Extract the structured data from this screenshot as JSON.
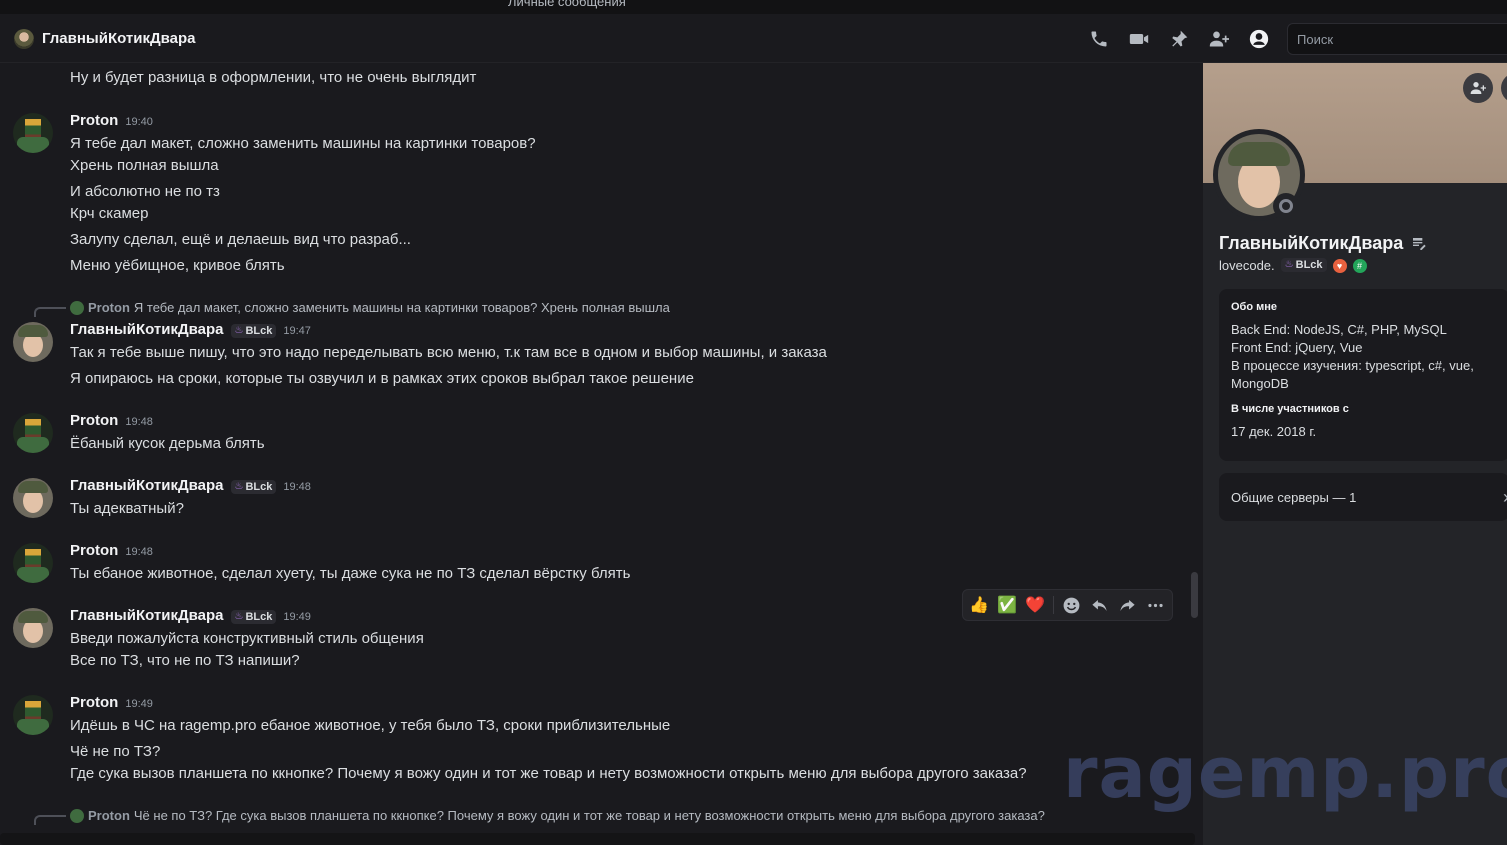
{
  "titlebar": {
    "text": "Личные сообщения"
  },
  "header": {
    "title": "ГлавныйКотикДвара",
    "search_placeholder": "Поиск"
  },
  "messages": {
    "m0_line": "Ну и будет разница в оформлении, что не очень выглядит",
    "m1": {
      "author": "Proton",
      "time": "19:40",
      "lines": [
        "Я тебе дал макет, сложно заменить машины на картинки товаров?",
        "Хрень полная вышла",
        "И абсолютно не по тз",
        "Крч скамер",
        "Залупу сделал, ещё и делаешь вид что разраб...",
        "Меню уёбищное, кривое блять"
      ]
    },
    "m2": {
      "reply_author": "Proton",
      "reply_text": "Я тебе дал макет, сложно заменить машины на картинки товаров? Хрень полная вышла",
      "author": "ГлавныйКотикДвара",
      "tag": "BLck",
      "time": "19:47",
      "lines": [
        "Так я тебе выше пишу, что это надо переделывать всю меню, т.к там все в одном и выбор машины, и заказа",
        "Я опираюсь на сроки, которые ты озвучил и в рамках этих сроков выбрал такое решение"
      ]
    },
    "m3": {
      "author": "Proton",
      "time": "19:48",
      "lines": [
        "Ёбаный кусок дерьма блять"
      ]
    },
    "m4": {
      "author": "ГлавныйКотикДвара",
      "tag": "BLck",
      "time": "19:48",
      "lines": [
        "Ты адекватный?"
      ]
    },
    "m5": {
      "author": "Proton",
      "time": "19:48",
      "lines": [
        "Ты ебаное животное, сделал хуету, ты даже сука не по ТЗ сделал вёрстку блять"
      ]
    },
    "m6": {
      "author": "ГлавныйКотикДвара",
      "tag": "BLck",
      "time": "19:49",
      "lines": [
        "Введи пожалуйста конструктивный стиль общения",
        "Все по ТЗ, что не по ТЗ напиши?"
      ]
    },
    "m7": {
      "author": "Proton",
      "time": "19:49",
      "lines": [
        "Идёшь в ЧС на ragemp.pro ебаное животное, у тебя было ТЗ, сроки приблизительные",
        "Чё не по ТЗ?",
        "Где сука вызов планшета по ккнопке? Почему я вожу один и тот же товар и нету возможности открыть меню для выбора другого заказа?"
      ]
    },
    "m8": {
      "reply_author": "Proton",
      "reply_text": "Чё не по ТЗ? Где сука вызов планшета по ккнопке? Почему я вожу один и тот же товар и нету возможности открыть меню для выбора другого заказа?"
    }
  },
  "message_actions": {
    "reactions": [
      "👍",
      "✅",
      "❤️"
    ]
  },
  "profile": {
    "name": "ГлавныйКотикДвара",
    "username": "lovecode.",
    "tag": "BLck",
    "about_heading": "Обо мне",
    "about_text": "Back End: NodeJS, C#, PHP, MySQL\nFront End: jQuery, Vue\nВ процессе изучения: typescript, c#, vue,\nMongoDB",
    "member_since_heading": "В числе участников с",
    "member_since": "17 дек. 2018 г.",
    "mutual_servers": "Общие серверы — 1"
  },
  "watermark": "ragemp.pro",
  "colors": {
    "background": "#1a1a1e",
    "panel": "#232428",
    "tag_flame": "#b07ae8",
    "badge_red": "#e8613f",
    "badge_green": "#23a55a"
  }
}
